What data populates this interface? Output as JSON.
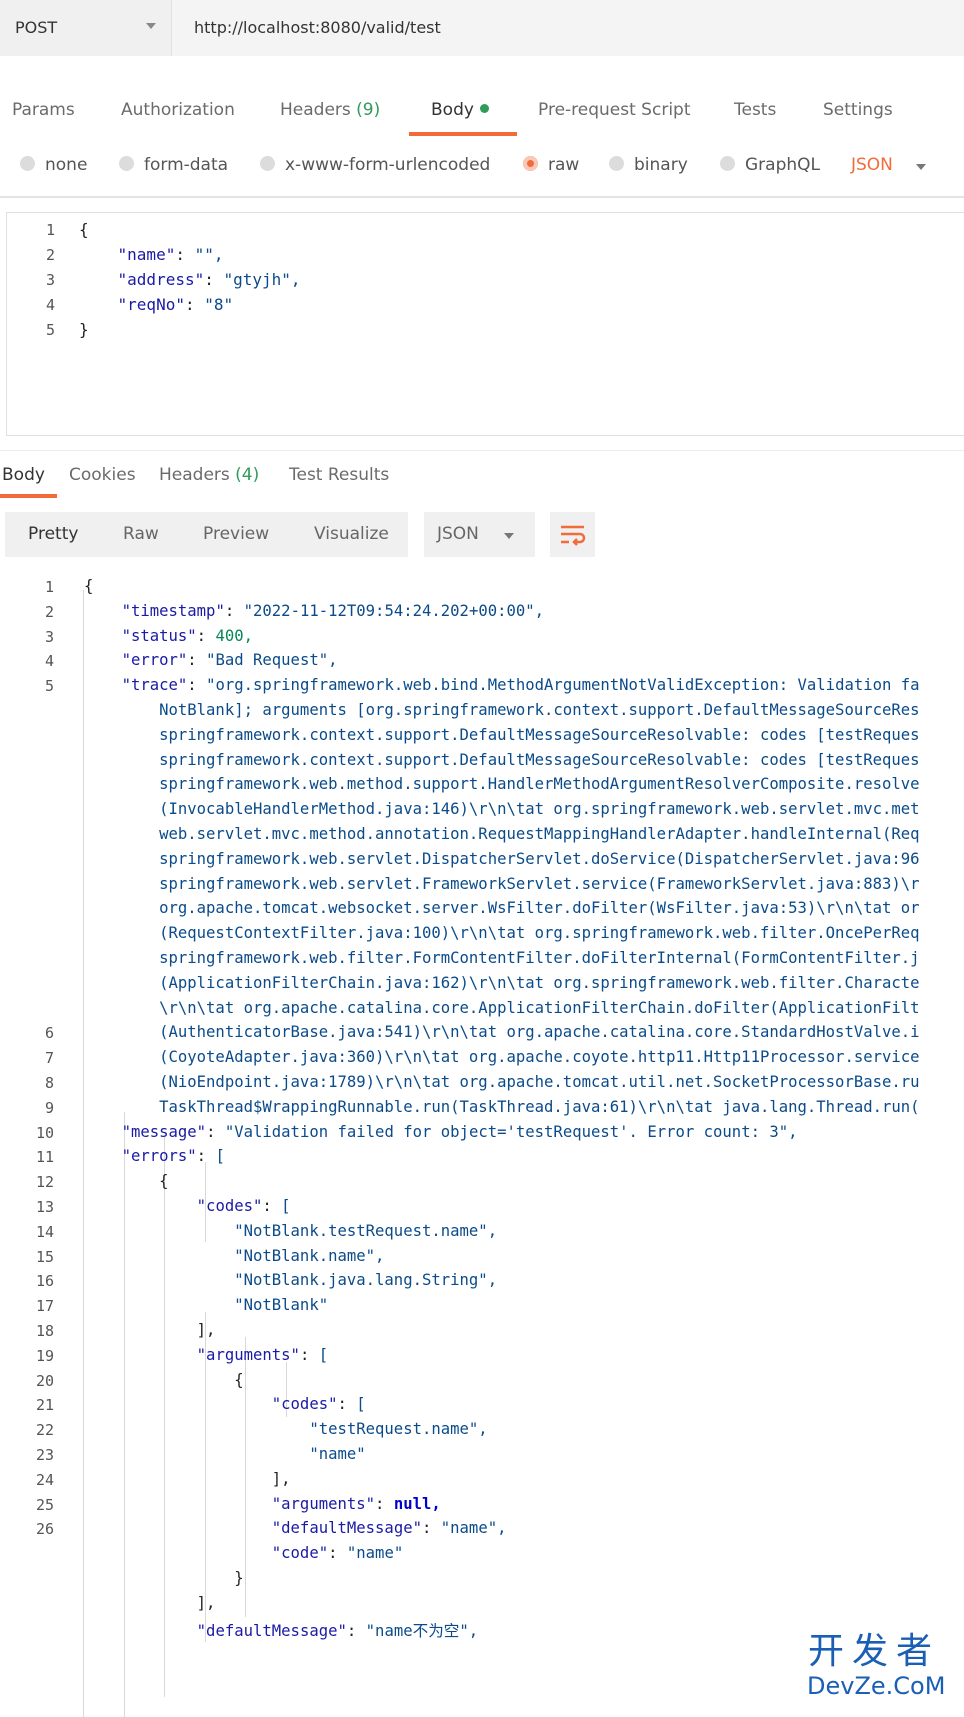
{
  "request": {
    "method": "POST",
    "url": "http://localhost:8080/valid/test",
    "tabs": {
      "params": "Params",
      "authorization": "Authorization",
      "headers": "Headers",
      "headers_count": "(9)",
      "body": "Body",
      "prerequest": "Pre-request Script",
      "tests": "Tests",
      "settings": "Settings"
    },
    "body_modes": {
      "none": "none",
      "form_data": "form-data",
      "urlencoded": "x-www-form-urlencoded",
      "raw": "raw",
      "binary": "binary",
      "graphql": "GraphQL",
      "selected": "raw"
    },
    "format": "JSON",
    "line_numbers": [
      "1",
      "2",
      "3",
      "4",
      "5"
    ],
    "body_lines": [
      {
        "pre": "{",
        "key": "",
        "post": "",
        "val": ""
      },
      {
        "pre": "    ",
        "key": "\"name\"",
        "post": ": ",
        "val": "\"\","
      },
      {
        "pre": "    ",
        "key": "\"address\"",
        "post": ": ",
        "val": "\"gtyjh\","
      },
      {
        "pre": "    ",
        "key": "\"reqNo\"",
        "post": ": ",
        "val": "\"8\""
      },
      {
        "pre": "}",
        "key": "",
        "post": "",
        "val": ""
      }
    ]
  },
  "response": {
    "tabs": {
      "body": "Body",
      "cookies": "Cookies",
      "headers": "Headers",
      "headers_count": "(4)",
      "test_results": "Test Results"
    },
    "views": {
      "pretty": "Pretty",
      "raw": "Raw",
      "preview": "Preview",
      "visualize": "Visualize"
    },
    "format": "JSON",
    "wrap_icon": "wrap-lines-icon",
    "line_numbers": [
      "1",
      "2",
      "3",
      "4",
      "5",
      "",
      "",
      "",
      "",
      "",
      "",
      "",
      "",
      "",
      "",
      "",
      "",
      "",
      "6",
      "7",
      "8",
      "9",
      "10",
      "11",
      "12",
      "13",
      "14",
      "15",
      "16",
      "17",
      "18",
      "19",
      "20",
      "21",
      "22",
      "23",
      "24",
      "25",
      "26"
    ],
    "lines": [
      "{",
      "    \"timestamp\": \"2022-11-12T09:54:24.202+00:00\",",
      "    \"status\": 400,",
      "    \"error\": \"Bad Request\",",
      "    \"trace\": \"org.springframework.web.bind.MethodArgumentNotValidException: Validation fa",
      "        NotBlank]; arguments [org.springframework.context.support.DefaultMessageSourceRes",
      "        springframework.context.support.DefaultMessageSourceResolvable: codes [testReques",
      "        springframework.context.support.DefaultMessageSourceResolvable: codes [testReques",
      "        springframework.web.method.support.HandlerMethodArgumentResolverComposite.resolve",
      "        (InvocableHandlerMethod.java:146)\\r\\n\\tat org.springframework.web.servlet.mvc.met",
      "        web.servlet.mvc.method.annotation.RequestMappingHandlerAdapter.handleInternal(Req",
      "        springframework.web.servlet.DispatcherServlet.doService(DispatcherServlet.java:96",
      "        springframework.web.servlet.FrameworkServlet.service(FrameworkServlet.java:883)\\r",
      "        org.apache.tomcat.websocket.server.WsFilter.doFilter(WsFilter.java:53)\\r\\n\\tat or",
      "        (RequestContextFilter.java:100)\\r\\n\\tat org.springframework.web.filter.OncePerReq",
      "        springframework.web.filter.FormContentFilter.doFilterInternal(FormContentFilter.j",
      "        (ApplicationFilterChain.java:162)\\r\\n\\tat org.springframework.web.filter.Characte",
      "        \\r\\n\\tat org.apache.catalina.core.ApplicationFilterChain.doFilter(ApplicationFilt",
      "        (AuthenticatorBase.java:541)\\r\\n\\tat org.apache.catalina.core.StandardHostValve.i",
      "        (CoyoteAdapter.java:360)\\r\\n\\tat org.apache.coyote.http11.Http11Processor.service",
      "        (NioEndpoint.java:1789)\\r\\n\\tat org.apache.tomcat.util.net.SocketProcessorBase.ru",
      "        TaskThread$WrappingRunnable.run(TaskThread.java:61)\\r\\n\\tat java.lang.Thread.run(",
      "    \"message\": \"Validation failed for object='testRequest'. Error count: 3\",",
      "    \"errors\": [",
      "        {",
      "            \"codes\": [",
      "                \"NotBlank.testRequest.name\",",
      "                \"NotBlank.name\",",
      "                \"NotBlank.java.lang.String\",",
      "                \"NotBlank\"",
      "            ],",
      "            \"arguments\": [",
      "                {",
      "                    \"codes\": [",
      "                        \"testRequest.name\",",
      "                        \"name\"",
      "                    ],",
      "                    \"arguments\": null,",
      "                    \"defaultMessage\": \"name\",",
      "                    \"code\": \"name\"",
      "                }",
      "            ],",
      "            \"defaultMessage\": \"name不为空\","
    ]
  },
  "watermark": {
    "top": "开发者",
    "bottom": "DevZe.CoM"
  },
  "colors": {
    "accent": "#f26b3a",
    "count_green": "#2f9c5a",
    "json_key": "#1a1aa6",
    "json_string": "#0b4b8a",
    "watermark": "#1a5fb4"
  }
}
